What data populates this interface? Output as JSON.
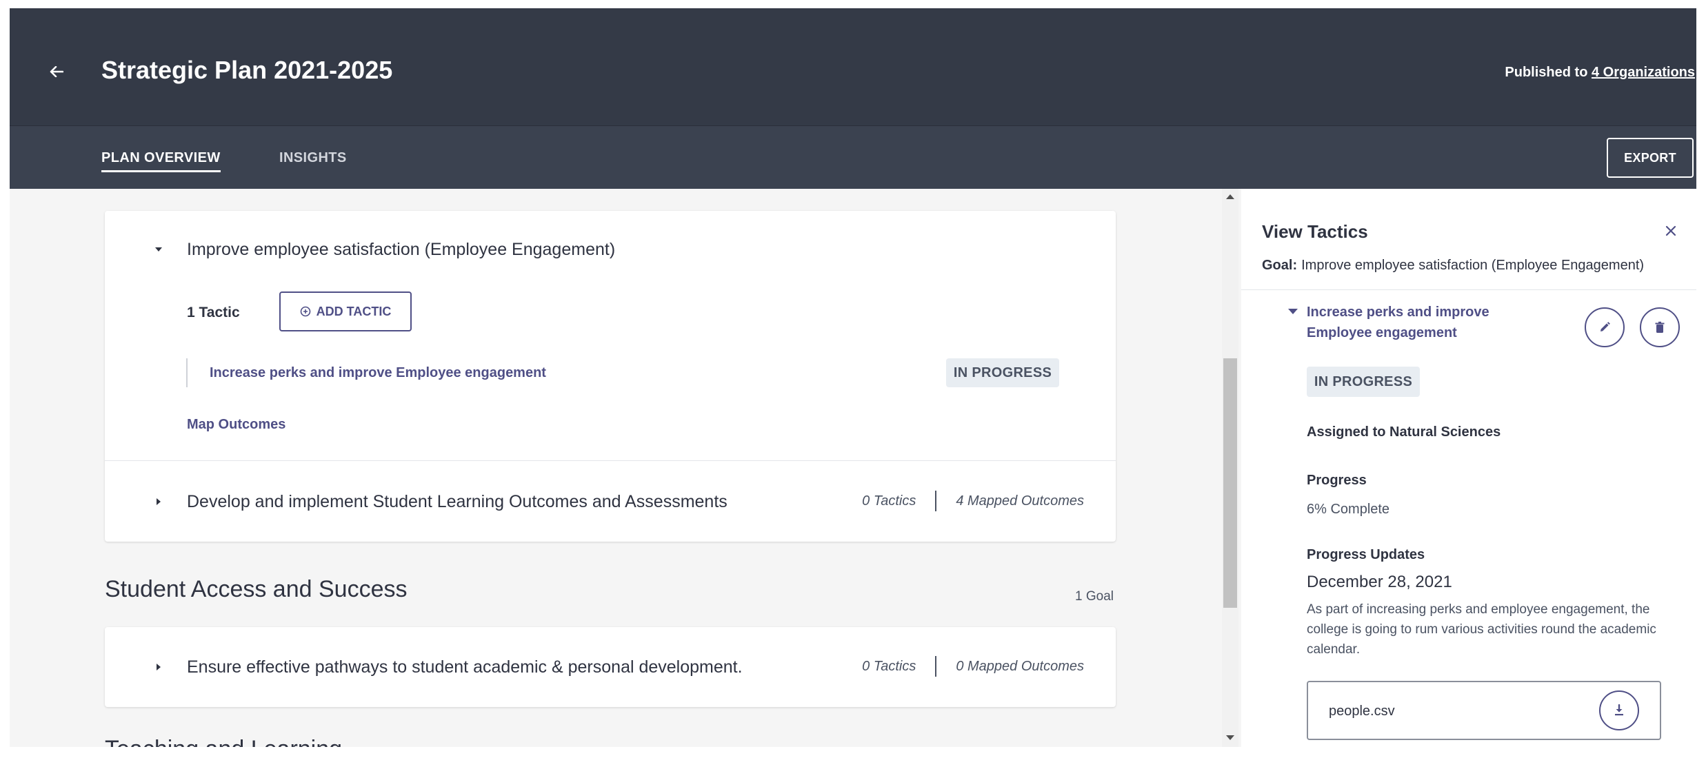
{
  "header": {
    "title": "Strategic Plan 2021-2025",
    "published_prefix": "Published to ",
    "published_link": "4 Organizations"
  },
  "tabs": [
    {
      "label": "PLAN OVERVIEW",
      "active": true
    },
    {
      "label": "INSIGHTS",
      "active": false
    }
  ],
  "actions": {
    "export_label": "EXPORT"
  },
  "goals_section_1": {
    "expanded_goal": {
      "title": "Improve employee satisfaction (Employee Engagement)",
      "tactic_count": "1 Tactic",
      "add_tactic_label": "ADD TACTIC",
      "tactic": {
        "name": "Increase perks and improve Employee engagement",
        "status": "IN PROGRESS"
      },
      "map_outcomes_label": "Map Outcomes"
    },
    "collapsed_goal": {
      "title": "Develop and implement Student Learning Outcomes and Assessments",
      "tactics": "0 Tactics",
      "outcomes": "4 Mapped Outcomes"
    }
  },
  "section_2": {
    "title": "Student Access and Success",
    "goal_count": "1 Goal",
    "goal": {
      "title": "Ensure effective pathways to student academic & personal development.",
      "tactics": "0 Tactics",
      "outcomes": "0 Mapped Outcomes"
    }
  },
  "section_3": {
    "title": "Teaching and Learning"
  },
  "panel": {
    "title": "View Tactics",
    "goal_label": "Goal:",
    "goal_value": "Improve employee satisfaction (Employee Engagement)",
    "tactic_title": "Increase perks and improve Employee engagement",
    "status": "IN PROGRESS",
    "assigned": "Assigned to Natural Sciences",
    "progress_label": "Progress",
    "progress_value": "6% Complete",
    "updates_label": "Progress Updates",
    "update_date": "December 28, 2021",
    "update_text": "As part of increasing perks and employee engagement, the college is going to rum various activities round the academic calendar.",
    "file_name": "people.csv"
  },
  "colors": {
    "header_bg": "#343a47",
    "accent": "#4f4f86",
    "badge_bg": "#e8edf2",
    "page_bg": "#f5f5f5"
  },
  "icons": [
    "back-arrow-icon",
    "add-circle-icon",
    "caret-down-icon",
    "caret-right-icon",
    "close-icon",
    "pencil-icon",
    "trash-icon",
    "download-icon"
  ]
}
